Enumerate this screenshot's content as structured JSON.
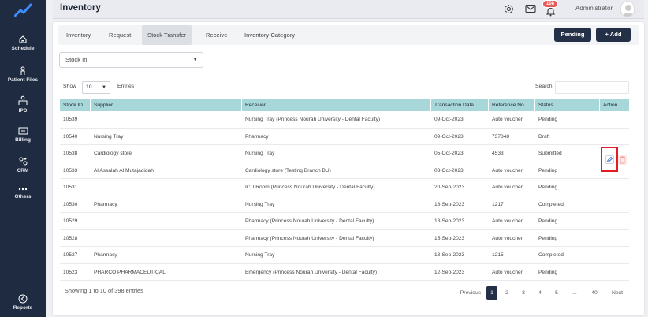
{
  "sidebar": {
    "items": [
      {
        "label": "Schedule",
        "icon": "home-icon"
      },
      {
        "label": "Patient Files",
        "icon": "person-icon"
      },
      {
        "label": "IPD",
        "icon": "bed-icon"
      },
      {
        "label": "Billing",
        "icon": "bill-icon"
      },
      {
        "label": "CRM",
        "icon": "crm-icon"
      },
      {
        "label": "Others",
        "icon": "more-icon"
      },
      {
        "label": "Reports",
        "icon": "reports-icon"
      }
    ]
  },
  "header": {
    "title": "Inventory",
    "notifications": "108",
    "user": "Administrator"
  },
  "tabs": [
    "Inventory",
    "Request",
    "Stock Transfer",
    "Receive",
    "Inventory Category"
  ],
  "buttons": {
    "pending": "Pending",
    "add": "+ Add"
  },
  "filter": {
    "value": "Stock In"
  },
  "table_controls": {
    "show": "Show",
    "length": "10",
    "entries": "Entries",
    "search": "Search:"
  },
  "table": {
    "columns": [
      "Stock ID",
      "Supplier",
      "Receiver",
      "Transaction Date",
      "Reference No",
      "Status",
      "Action"
    ],
    "rows": [
      [
        "10539",
        "",
        "Nursing Tray (Princess Nourah University - Dental Faculty)",
        "09-Oct-2023",
        "Auto voucher",
        "Pending"
      ],
      [
        "10540",
        "Nursing Tray",
        "Pharmacy",
        "09-Oct-2023",
        "737848",
        "Draft"
      ],
      [
        "10538",
        "Cardiology store",
        "Nursing Tray",
        "05-Oct-2023",
        "4533",
        "Submitted"
      ],
      [
        "10533",
        "Al Assalah Al Mutajadidah",
        "Cardiology store (Testing Branch BU)",
        "03-Oct-2023",
        "Auto voucher",
        "Pending"
      ],
      [
        "10531",
        "",
        "ICU Room (Princess Nourah University - Dental Faculty)",
        "20-Sep-2023",
        "Auto voucher",
        "Pending"
      ],
      [
        "10530",
        "Pharmacy",
        "Nursing Tray",
        "18-Sep-2023",
        "1217",
        "Completed"
      ],
      [
        "10529",
        "",
        "Pharmacy (Princess Nourah University - Dental Faculty)",
        "18-Sep-2023",
        "Auto voucher",
        "Pending"
      ],
      [
        "10528",
        "",
        "Pharmacy (Princess Nourah University - Dental Faculty)",
        "15-Sep-2023",
        "Auto voucher",
        "Pending"
      ],
      [
        "10527",
        "Pharmacy",
        "Nursing Tray",
        "13-Sep-2023",
        "1215",
        "Completed"
      ],
      [
        "10523",
        "PHARCO PHARMACEUTICAL",
        "Emergency (Princess Nourah University - Dental Faculty)",
        "12-Sep-2023",
        "Auto voucher",
        "Pending"
      ]
    ]
  },
  "footer": {
    "info": "Showing 1 to 10 of 398 entries",
    "pages": [
      "Previous",
      "1",
      "2",
      "3",
      "4",
      "5",
      "...",
      "40",
      "Next"
    ]
  },
  "colors": {
    "sidebar": "#1f2b40",
    "accent": "#233047",
    "header_row": "#a7d7d8",
    "highlight": "#e31b23"
  }
}
